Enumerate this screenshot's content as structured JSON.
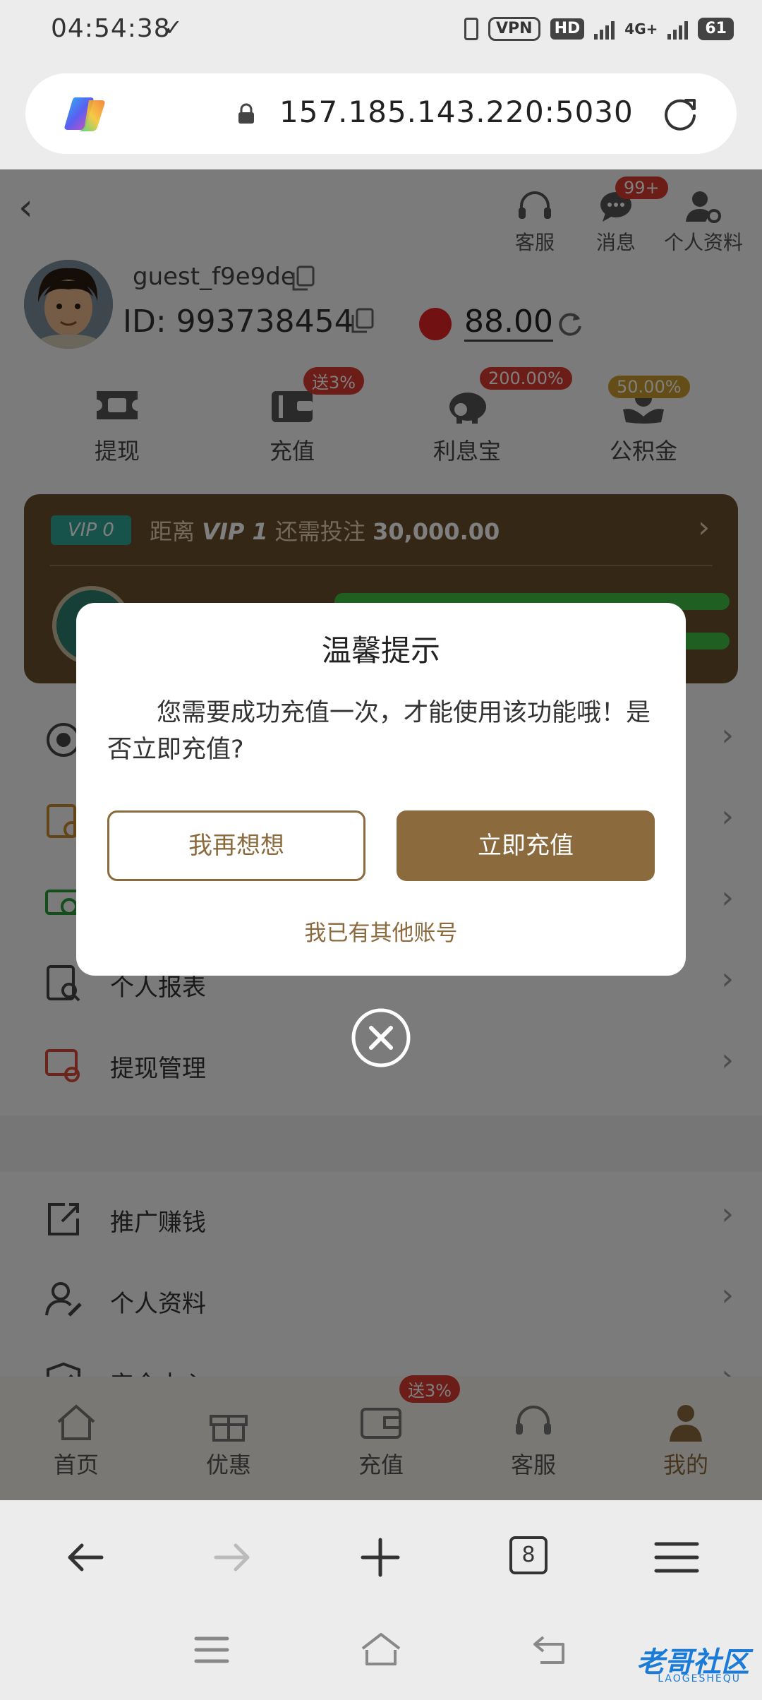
{
  "status_bar": {
    "time": "04:54:38",
    "vpn": "VPN",
    "hd": "HD",
    "network": "4G+",
    "battery": "61"
  },
  "browser": {
    "url": "157.185.143.220:5030",
    "tab_count": "8"
  },
  "header": {
    "icons": [
      {
        "label": "客服"
      },
      {
        "label": "消息",
        "badge": "99+"
      },
      {
        "label": "个人资料"
      }
    ]
  },
  "profile": {
    "username": "guest_f9e9de",
    "user_id": "ID: 993738454",
    "balance": "88.00"
  },
  "actions": [
    {
      "label": "提现"
    },
    {
      "label": "充值",
      "badge": "送3%"
    },
    {
      "label": "利息宝",
      "badge": "200.00%"
    },
    {
      "label": "公积金",
      "badge": "50.00%"
    }
  ],
  "vip": {
    "tag": "VIP 0",
    "text_prefix": "距离",
    "level": "VIP 1",
    "text_mid": "还需投注",
    "amount": "30,000.00"
  },
  "menu": {
    "group1": [
      {
        "label": "个人报表"
      },
      {
        "label": "提现管理"
      }
    ],
    "group2": [
      {
        "label": "推广赚钱"
      },
      {
        "label": "个人资料"
      },
      {
        "label": "安全中心"
      }
    ]
  },
  "bottom_nav": [
    {
      "label": "首页"
    },
    {
      "label": "优惠"
    },
    {
      "label": "充值",
      "badge": "送3%"
    },
    {
      "label": "客服"
    },
    {
      "label": "我的"
    }
  ],
  "dialog": {
    "title": "温馨提示",
    "message": "您需要成功充值一次，才能使用该功能哦！是否立即充值?",
    "cancel_label": "我再想想",
    "confirm_label": "立即充值",
    "other_account_label": "我已有其他账号"
  },
  "watermark": {
    "text": "老哥社区",
    "sub": "LAOGESHEQU"
  },
  "colors": {
    "accent": "#8b6a3e",
    "vip_card": "#6b4f2a",
    "badge": "#d83a2e"
  }
}
